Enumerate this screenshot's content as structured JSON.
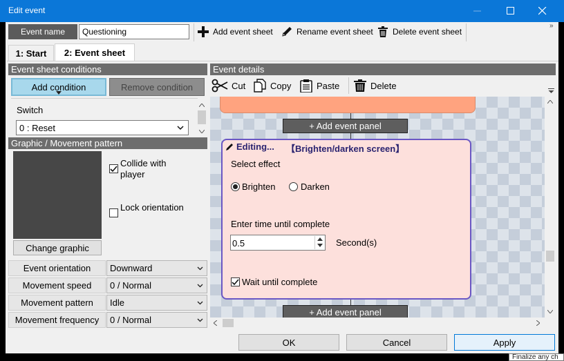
{
  "window": {
    "title": "Edit event",
    "minimize_icon": "minimize-icon",
    "maximize_icon": "maximize-icon",
    "close_icon": "close-icon"
  },
  "toolbar": {
    "event_name_label": "Event name",
    "event_name_value": "Questioning",
    "add_sheet": "Add event sheet",
    "rename_sheet": "Rename event sheet",
    "delete_sheet": "Delete event sheet",
    "more": "»"
  },
  "tabs": [
    {
      "label": "1: Start",
      "active": false
    },
    {
      "label": "2: Event sheet",
      "active": true
    }
  ],
  "conditions": {
    "header": "Event sheet conditions",
    "add_button": "Add condition",
    "remove_button": "Remove condition",
    "switch_label": "Switch",
    "switch_value": "0 : Reset"
  },
  "graphic": {
    "header": "Graphic / Movement pattern",
    "collide_label": "Collide  with player",
    "collide_checked": true,
    "lock_label": "Lock orientation",
    "lock_checked": false,
    "change_button": "Change graphic"
  },
  "properties": [
    {
      "label": "Event orientation",
      "value": "Downward"
    },
    {
      "label": "Movement speed",
      "value": "0 / Normal"
    },
    {
      "label": "Movement pattern",
      "value": "Idle"
    },
    {
      "label": "Movement frequency",
      "value": "0 / Normal"
    }
  ],
  "details": {
    "header": "Event details",
    "cut": "Cut",
    "copy": "Copy",
    "paste": "Paste",
    "delete": "Delete"
  },
  "canvas": {
    "add_panel": "+ Add event panel",
    "editing_title": "Editing...",
    "editing_command": "【Brighten/darken screen】",
    "select_effect": "Select effect",
    "brighten": "Brighten",
    "darken": "Darken",
    "selected_effect": "Brighten",
    "time_label": "Enter time until complete",
    "time_value": "0.5",
    "time_unit": "Second(s)",
    "wait_label": "Wait until complete",
    "wait_checked": true
  },
  "buttons": {
    "ok": "OK",
    "cancel": "Cancel",
    "apply": "Apply"
  },
  "tooltip": "Finalize any ch",
  "colors": {
    "titlebar": "#0b77d8",
    "panel_top": "#ffa37f",
    "editing_panel": "#fde0dc",
    "editing_border": "#6a57c4"
  }
}
